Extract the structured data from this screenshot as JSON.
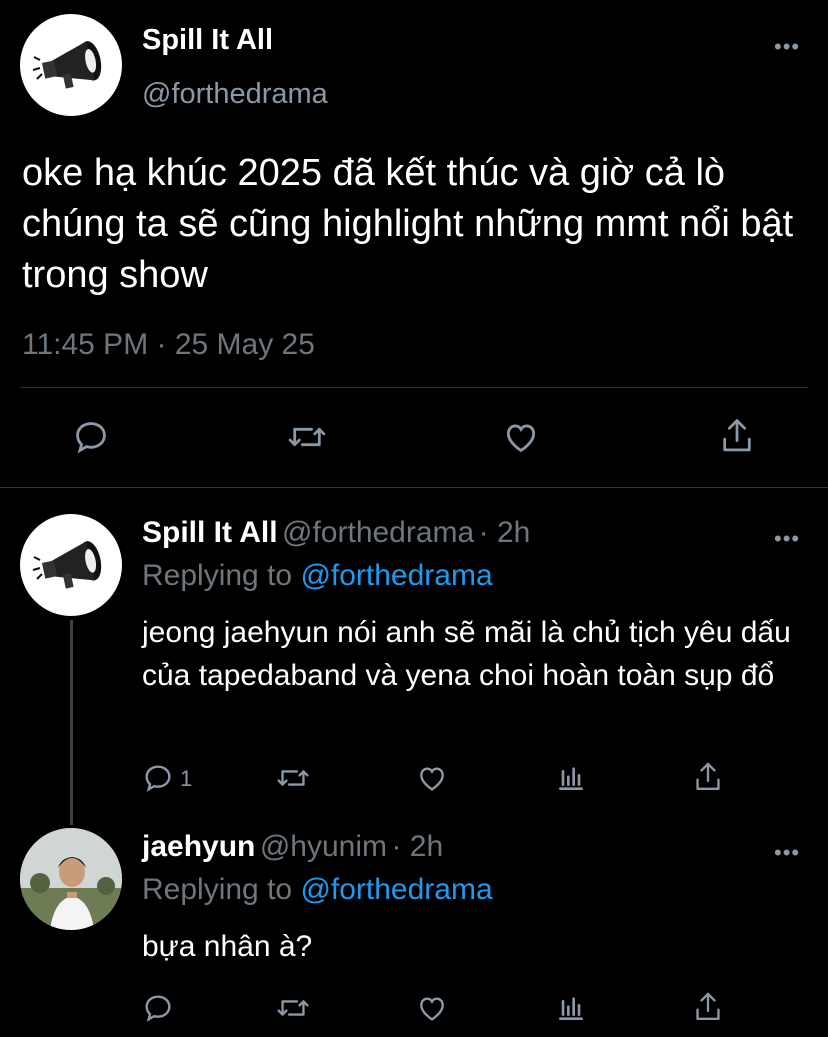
{
  "main_tweet": {
    "author_name": "Spill It All",
    "author_handle": "@forthedrama",
    "text": "oke hạ khúc 2025 đã kết thúc và giờ cả lò chúng ta sẽ cũng highlight những mmt nổi bật trong show",
    "timestamp": "11:45 PM · 25 May 25",
    "more_label": "•••"
  },
  "replies": [
    {
      "author_name": "Spill It All",
      "author_handle": "@forthedrama",
      "time_ago": "· 2h",
      "replying_prefix": "Replying to ",
      "replying_to": "@forthedrama",
      "text": "jeong jaehyun nói anh sẽ mãi là chủ tịch yêu dấu của tapedaband và yena choi hoàn toàn sụp đổ",
      "reply_count": "1",
      "more_label": "•••"
    },
    {
      "author_name": "jaehyun",
      "author_handle": "@hyunim",
      "time_ago": "· 2h",
      "replying_prefix": "Replying to ",
      "replying_to": "@forthedrama",
      "text": "bựa nhân à?",
      "reply_count": "",
      "more_label": "•••"
    }
  ],
  "icons": [
    "reply-icon",
    "retweet-icon",
    "like-icon",
    "share-icon",
    "analytics-icon",
    "megaphone-icon"
  ],
  "colors": {
    "background": "#000000",
    "link": "#1d9bf0",
    "secondary": "#8b98a5"
  }
}
